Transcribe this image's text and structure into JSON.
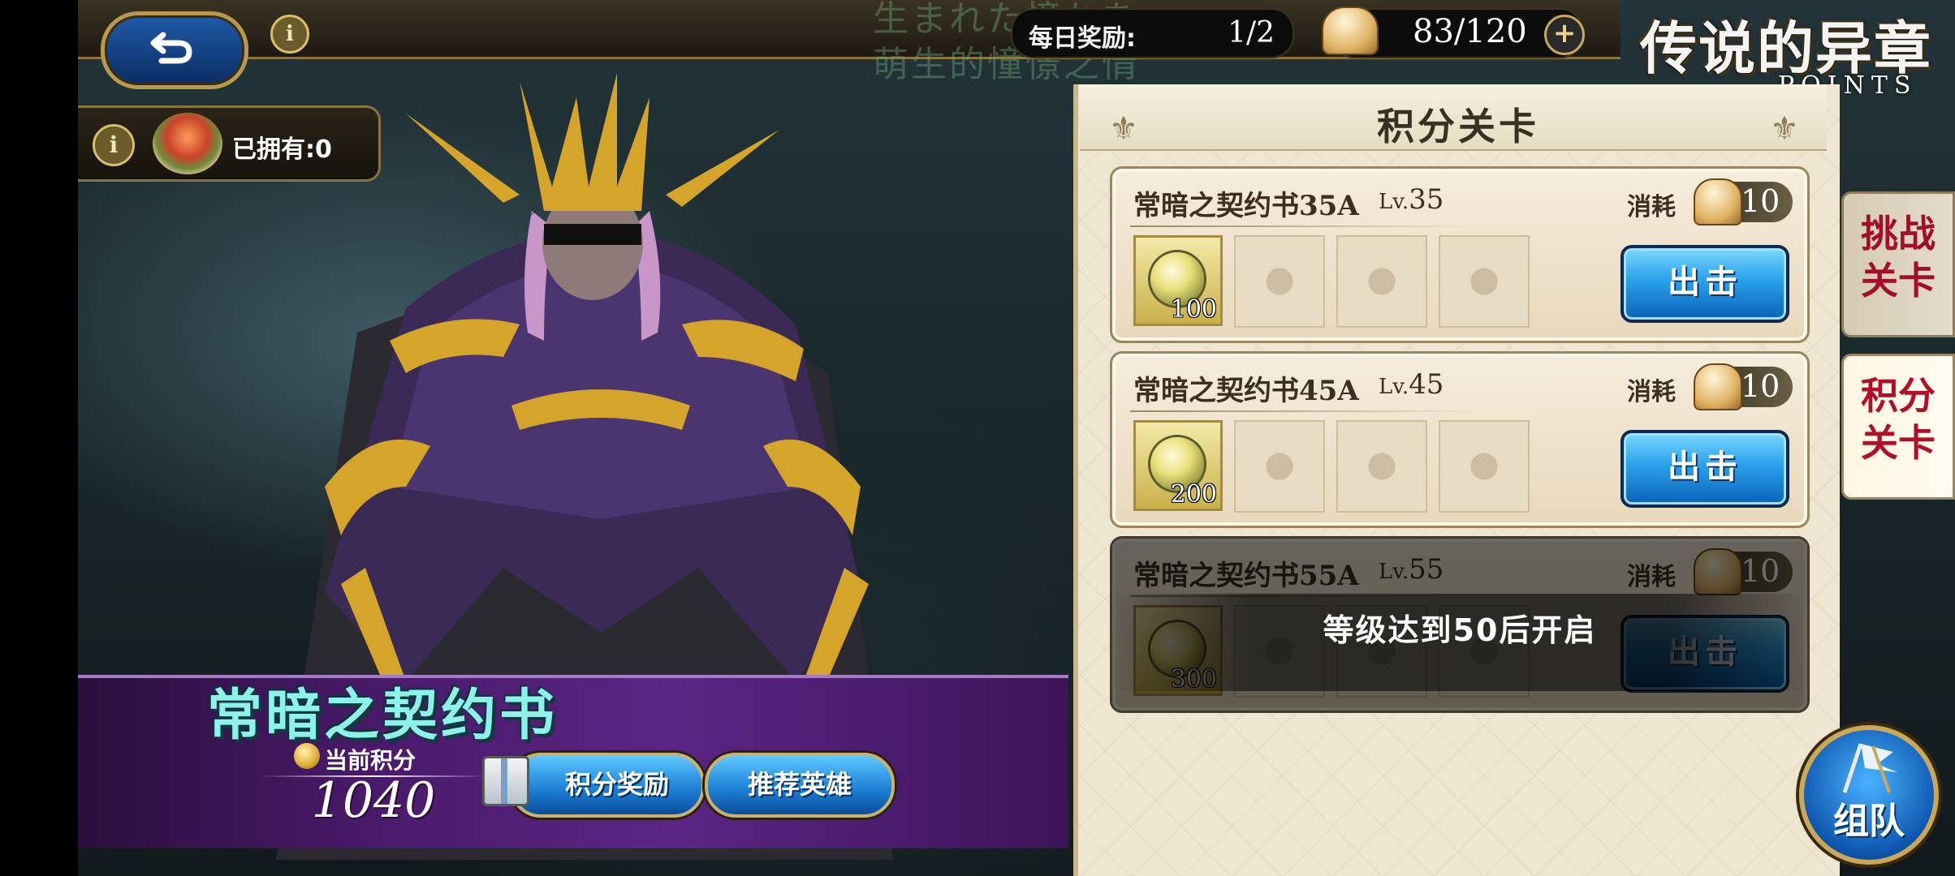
{
  "top_bar": {
    "bg_text_line1": "生まれた憧れを",
    "bg_text_line2": "萌生的憧憬之情",
    "daily_label": "每日奖励:",
    "daily_value": "1/2",
    "stamina": "83/120",
    "plus": "+",
    "info": "i"
  },
  "logo": {
    "title": "传说的异章",
    "subtitle": "POINTS"
  },
  "owned": {
    "label": "已拥有:0"
  },
  "banner": {
    "title": "常暗之契约书",
    "points_label": "当前积分",
    "points_value": "1040",
    "rewards_button": "积分奖励",
    "heroes_button": "推荐英雄"
  },
  "panel": {
    "title": "积分关卡",
    "stages": [
      {
        "name": "常暗之契约书35A",
        "lv_prefix": "Lv.",
        "lv": "35",
        "cost_label": "消耗",
        "cost": "10",
        "reward_qty": "100",
        "button": "出击"
      },
      {
        "name": "常暗之契约书45A",
        "lv_prefix": "Lv.",
        "lv": "45",
        "cost_label": "消耗",
        "cost": "10",
        "reward_qty": "200",
        "button": "出击"
      },
      {
        "name": "常暗之契约书55A",
        "lv_prefix": "Lv.",
        "lv": "55",
        "cost_label": "消耗",
        "cost": "10",
        "reward_qty": "300",
        "button": "出击",
        "locked_text": "等级达到50后开启"
      }
    ]
  },
  "side_tabs": {
    "challenge": "挑战关卡",
    "points": "积分关卡"
  },
  "team_button": "组队",
  "colors": {
    "banner_title": "#8ff2ea",
    "side_tab_text": "#b0102a",
    "sortie_button": "#2aa0ea",
    "banner_purple": "#4a1a6a"
  }
}
